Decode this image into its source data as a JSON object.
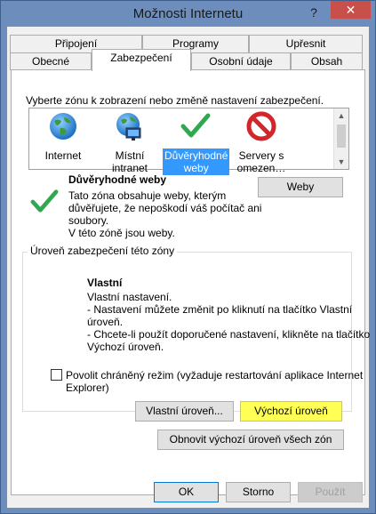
{
  "window": {
    "title": "Možnosti Internetu"
  },
  "titlebar": {
    "help": "?",
    "close": "✕"
  },
  "tabs_back": [
    "Připojení",
    "Programy",
    "Upřesnit"
  ],
  "tabs_front": [
    "Obecné",
    "Zabezpečení",
    "Osobní údaje",
    "Obsah"
  ],
  "zone_section": {
    "instruction": "Vyberte zónu k zobrazení nebo změně nastavení zabezpečení."
  },
  "zones": [
    {
      "label": "Internet",
      "icon": "globe-icon"
    },
    {
      "label": "Místní intranet",
      "icon": "network-globe-icon"
    },
    {
      "label_line1": "Důvěryhodné",
      "label_line2": "weby",
      "icon": "checkmark-icon",
      "selected": true
    },
    {
      "label_line1": "Servery s",
      "label_line2": "omezen…",
      "icon": "forbidden-icon"
    }
  ],
  "zone_details": {
    "title": "Důvěryhodné weby",
    "desc_line1": "Tato zóna obsahuje weby, kterým",
    "desc_line2": "důvěřujete, že nepoškodí váš počítač ani",
    "desc_line3": "soubory.",
    "desc_line4": "V této zóně jsou weby.",
    "sites_button": "Weby"
  },
  "security_level": {
    "group_title": "Úroveň zabezpečení této zóny",
    "level_title": "Vlastní",
    "line1": "Vlastní nastavení.",
    "line2": "- Nastavení můžete změnit po kliknutí na tlačítko Vlastní",
    "line3": "úroveň.",
    "line4": "- Chcete-li použít doporučené nastavení, klikněte na tlačítko",
    "line5": "Výchozí úroveň.",
    "protected_mode_line1": "Povolit chráněný režim (vyžaduje restartování aplikace Internet",
    "protected_mode_line2": "Explorer)",
    "protected_mode_checked": false,
    "custom_level_button": "Vlastní úroveň...",
    "default_level_button": "Výchozí úroveň"
  },
  "reset_all_button": "Obnovit výchozí úroveň všech zón",
  "footer": {
    "ok": "OK",
    "cancel": "Storno",
    "apply": "Použít"
  },
  "colors": {
    "titlebar": "#6d8ebc",
    "close": "#c7504a",
    "selection": "#3399ff",
    "check_green": "#2fa84f",
    "highlight": "#ffff55"
  }
}
